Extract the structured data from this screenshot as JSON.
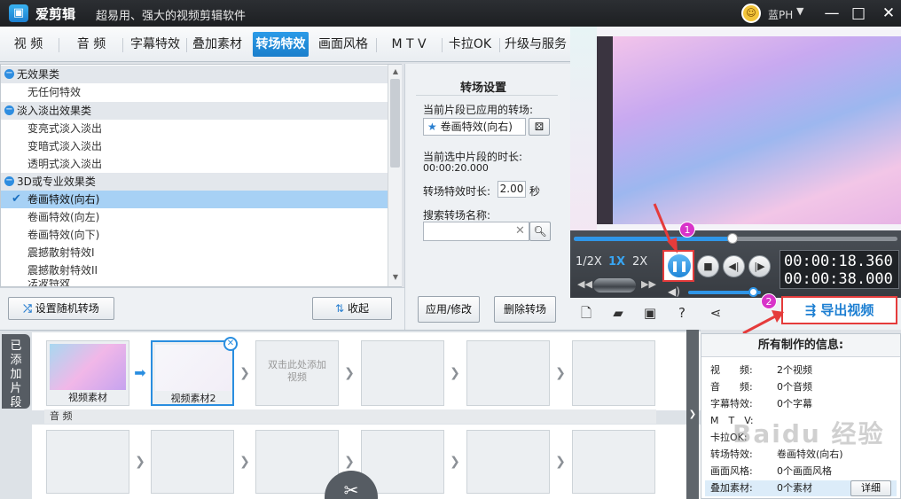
{
  "app": {
    "name": "爱剪辑",
    "slogan": "超易用、强大的视频剪辑软件",
    "username": "蓝PH",
    "user_dropdown": "▼",
    "win_min": "—",
    "win_max": "□",
    "win_close": "✕"
  },
  "tabs": [
    "视 频",
    "音 频",
    "字幕特效",
    "叠加素材",
    "转场特效",
    "画面风格",
    "M T V",
    "卡拉OK",
    "升级与服务"
  ],
  "active_tab": "转场特效",
  "effects": {
    "categories": [
      {
        "name": "无效果类",
        "items": [
          "无任何特效"
        ]
      },
      {
        "name": "淡入淡出效果类",
        "items": [
          "变亮式淡入淡出",
          "变暗式淡入淡出",
          "透明式淡入淡出"
        ]
      },
      {
        "name": "3D或专业效果类",
        "items": [
          "卷画特效(向右)",
          "卷画特效(向左)",
          "卷画特效(向下)",
          "震撼散射特效I",
          "震撼散射特效II",
          "法波特效"
        ]
      }
    ],
    "selected": "卷画特效(向右)",
    "random_button": "设置随机转场",
    "collapse_button": "收起"
  },
  "settings": {
    "title": "转场设置",
    "applied_label": "当前片段已应用的转场:",
    "applied_value": "卷画特效(向右)",
    "duration_label": "当前选中片段的时长:",
    "duration_value": "00:00:20.000",
    "effect_duration_label": "转场特效时长:",
    "effect_duration_value": "2.00",
    "effect_duration_unit": "秒",
    "search_label": "搜索转场名称:",
    "search_value": "",
    "apply_button": "应用/修改",
    "delete_button": "删除转场"
  },
  "player": {
    "speeds": [
      "1/2X",
      "1X",
      "2X"
    ],
    "active_speed": "1X",
    "progress": 0.49,
    "volume": 0.9,
    "time_current": "00:00:18.360",
    "time_total": "00:00:38.000"
  },
  "toolbar": {
    "export_button": "导出视频"
  },
  "annotations": {
    "badge1": "1",
    "badge2": "2"
  },
  "timeline": {
    "added_label": "已添加片段",
    "clips": [
      "视频素材",
      "视频素材2"
    ],
    "add_hint": "双击此处添加视频",
    "audio_label": "音 频"
  },
  "info": {
    "title": "所有制作的信息:",
    "rows": [
      {
        "label": "视　　频:",
        "value": "2个视频"
      },
      {
        "label": "音　　频:",
        "value": "0个音频"
      },
      {
        "label": "字幕特效:",
        "value": "0个字幕"
      },
      {
        "label": "M　T　V:",
        "value": ""
      },
      {
        "label": "卡拉OK:",
        "value": ""
      },
      {
        "label": "转场特效:",
        "value": "卷画特效(向右)"
      },
      {
        "label": "画面风格:",
        "value": "0个画面风格"
      },
      {
        "label": "叠加素材:",
        "value": "0个素材"
      }
    ],
    "detail_button": "详细"
  },
  "watermark": "Baidu 经验",
  "colors": {
    "accent": "#1a7fcc",
    "highlight_red": "#e53b3b",
    "badge": "#d833c9",
    "selected_row": "#a7d1f5"
  }
}
